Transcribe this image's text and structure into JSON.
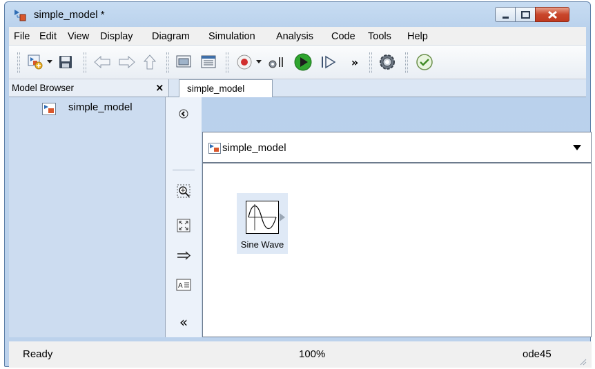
{
  "window": {
    "title": "simple_model *",
    "controls": [
      "minimize",
      "maximize",
      "close"
    ]
  },
  "menu": [
    "File",
    "Edit",
    "View",
    "Display",
    "Diagram",
    "Simulation",
    "Analysis",
    "Code",
    "Tools",
    "Help"
  ],
  "toolbar": {
    "icons": [
      "new-model-icon",
      "save-icon",
      "back-icon",
      "forward-icon",
      "up-icon",
      "library-browser-icon",
      "model-explorer-icon",
      "record-icon",
      "step-back-icon",
      "run-icon",
      "step-forward-icon",
      "more-icon",
      "settings-icon",
      "check-icon"
    ],
    "overflow": "»"
  },
  "model_browser": {
    "title": "Model Browser",
    "close": "×",
    "items": [
      {
        "label": "simple_model"
      }
    ]
  },
  "tabs": [
    {
      "label": "simple_model"
    }
  ],
  "address_bar": {
    "label": "simple_model"
  },
  "palette": {
    "icons": [
      "hide-browser-icon",
      "zoom-icon",
      "fit-view-icon",
      "arrow-icon",
      "annotation-icon",
      "collapse-icon"
    ],
    "collapse": "«"
  },
  "canvas": {
    "blocks": [
      {
        "name": "Sine Wave"
      }
    ]
  },
  "status": {
    "state": "Ready",
    "zoom": "100%",
    "solver": "ode45"
  },
  "colors": {
    "title_bar": "#c7dcf2",
    "close_button": "#c8462b",
    "browser_panel": "#ccdcf0",
    "run_green": "#2fa52f",
    "record_red": "#d12f2f"
  }
}
